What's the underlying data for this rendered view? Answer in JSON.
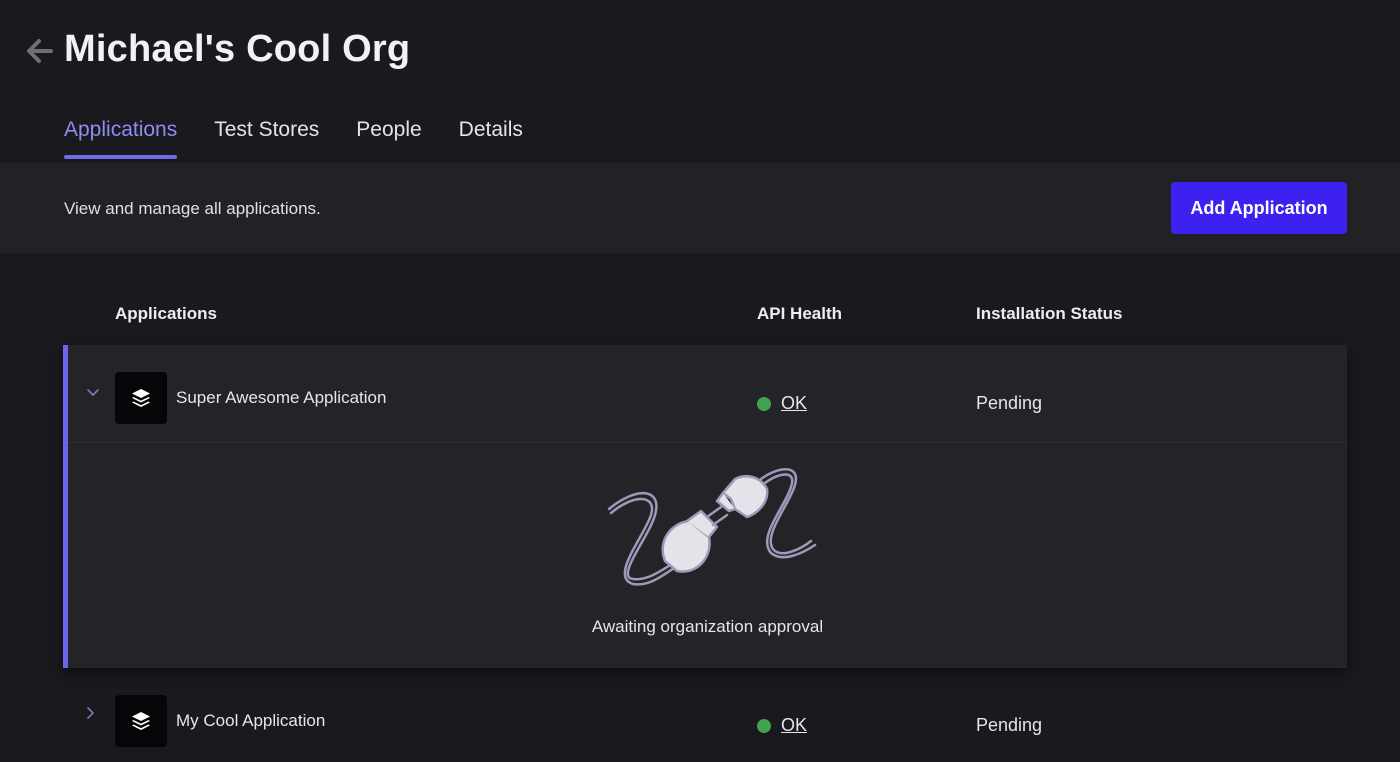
{
  "header": {
    "title": "Michael's Cool Org",
    "back_icon": "arrow-left-icon"
  },
  "tabs": [
    {
      "label": "Applications",
      "active": true
    },
    {
      "label": "Test Stores",
      "active": false
    },
    {
      "label": "People",
      "active": false
    },
    {
      "label": "Details",
      "active": false
    }
  ],
  "subbar": {
    "description": "View and manage all applications.",
    "add_button": "Add Application"
  },
  "table": {
    "columns": [
      "Applications",
      "API Health",
      "Installation Status"
    ],
    "rows": [
      {
        "name": "Super Awesome Application",
        "health": "OK",
        "status": "Pending",
        "expanded": true,
        "icon": "layers-icon",
        "expanded_message": "Awaiting organization approval",
        "illustration": "unplugged-plug-icon"
      },
      {
        "name": "My Cool Application",
        "health": "OK",
        "status": "Pending",
        "expanded": false,
        "icon": "layers-icon"
      }
    ]
  },
  "colors": {
    "accent": "#6a65ec",
    "button": "#3d21f0",
    "health_ok": "#3fa34d",
    "background": "#1a191e"
  }
}
